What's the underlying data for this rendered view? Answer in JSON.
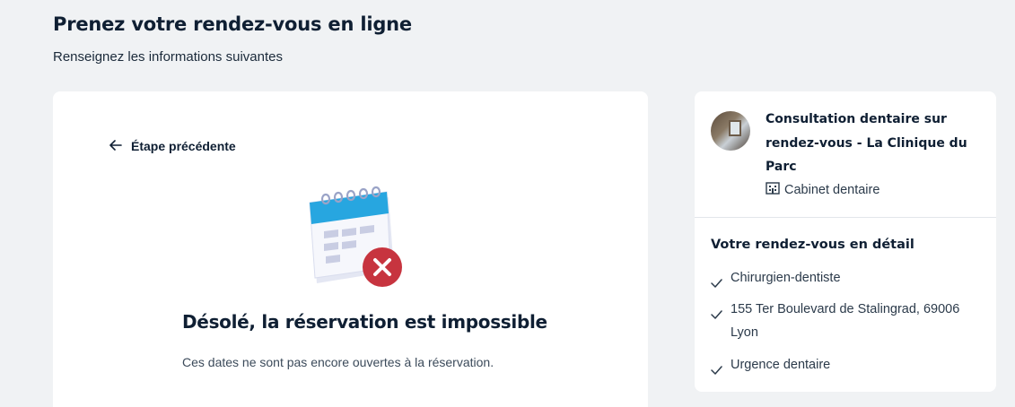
{
  "header": {
    "title": "Prenez votre rendez-vous en ligne",
    "subtitle": "Renseignez les informations suivantes"
  },
  "main": {
    "back_label": "Étape précédente",
    "error_title": "Désolé, la réservation est impossible",
    "error_text": "Ces dates ne sont pas encore ouvertes à la réservation."
  },
  "sidebar": {
    "clinic_name": "Consultation dentaire sur rendez-vous - La Clinique du Parc",
    "clinic_type": "Cabinet dentaire",
    "detail_title": "Votre rendez-vous en détail",
    "details": [
      "Chirurgien-dentiste",
      "155 Ter Boulevard de Stalingrad, 69006 Lyon",
      "Urgence dentaire"
    ]
  },
  "colors": {
    "accent_blue": "#27a6e0",
    "error_red": "#c7343f",
    "text_dark": "#0f1f33"
  }
}
